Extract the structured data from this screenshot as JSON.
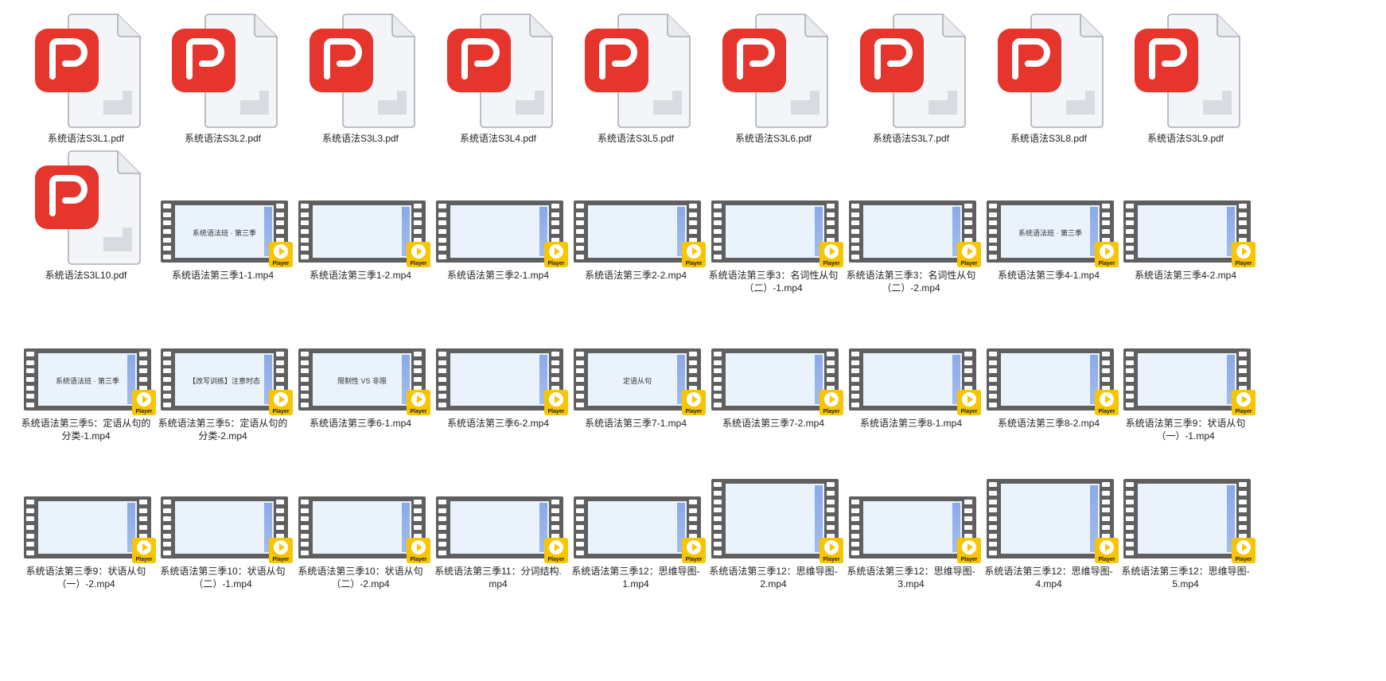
{
  "colors": {
    "pdf_red": "#e5352d",
    "player_yellow": "#f7c600",
    "film_gray": "#5f5f5f"
  },
  "player_badge": "Player",
  "files": [
    {
      "name": "系统语法S3L1.pdf",
      "type": "pdf"
    },
    {
      "name": "系统语法S3L2.pdf",
      "type": "pdf"
    },
    {
      "name": "系统语法S3L3.pdf",
      "type": "pdf"
    },
    {
      "name": "系统语法S3L4.pdf",
      "type": "pdf"
    },
    {
      "name": "系统语法S3L5.pdf",
      "type": "pdf"
    },
    {
      "name": "系统语法S3L6.pdf",
      "type": "pdf"
    },
    {
      "name": "系统语法S3L7.pdf",
      "type": "pdf"
    },
    {
      "name": "系统语法S3L8.pdf",
      "type": "pdf"
    },
    {
      "name": "系统语法S3L9.pdf",
      "type": "pdf"
    },
    {
      "name": "系统语法S3L10.pdf",
      "type": "pdf"
    },
    {
      "name": "系统语法第三季1-1.mp4",
      "type": "mp4",
      "screen": "系统语法班 · 第三季"
    },
    {
      "name": "系统语法第三季1-2.mp4",
      "type": "mp4"
    },
    {
      "name": "系统语法第三季2-1.mp4",
      "type": "mp4"
    },
    {
      "name": "系统语法第三季2-2.mp4",
      "type": "mp4"
    },
    {
      "name": "系统语法第三季3：名词性从句（二）-1.mp4",
      "type": "mp4"
    },
    {
      "name": "系统语法第三季3：名词性从句（二）-2.mp4",
      "type": "mp4"
    },
    {
      "name": "系统语法第三季4-1.mp4",
      "type": "mp4",
      "screen": "系统语法班 · 第三季"
    },
    {
      "name": "系统语法第三季4-2.mp4",
      "type": "mp4"
    },
    {
      "name": "系统语法第三季5：定语从句的分类-1.mp4",
      "type": "mp4",
      "screen": "系统语法班 · 第三季"
    },
    {
      "name": "系统语法第三季5：定语从句的分类-2.mp4",
      "type": "mp4",
      "screen": "【改写训练】注意时态"
    },
    {
      "name": "系统语法第三季6-1.mp4",
      "type": "mp4",
      "screen": "限制性 VS 非限"
    },
    {
      "name": "系统语法第三季6-2.mp4",
      "type": "mp4"
    },
    {
      "name": "系统语法第三季7-1.mp4",
      "type": "mp4",
      "screen": "定语从句"
    },
    {
      "name": "系统语法第三季7-2.mp4",
      "type": "mp4"
    },
    {
      "name": "系统语法第三季8-1.mp4",
      "type": "mp4"
    },
    {
      "name": "系统语法第三季8-2.mp4",
      "type": "mp4"
    },
    {
      "name": "系统语法第三季9：状语从句（一）-1.mp4",
      "type": "mp4"
    },
    {
      "name": "系统语法第三季9：状语从句（一）-2.mp4",
      "type": "mp4"
    },
    {
      "name": "系统语法第三季10：状语从句（二）-1.mp4",
      "type": "mp4"
    },
    {
      "name": "系统语法第三季10：状语从句（二）-2.mp4",
      "type": "mp4"
    },
    {
      "name": "系统语法第三季11：分词结构.mp4",
      "type": "mp4"
    },
    {
      "name": "系统语法第三季12：思维导图-1.mp4",
      "type": "mp4"
    },
    {
      "name": "系统语法第三季12：思维导图-2.mp4",
      "type": "mp4"
    },
    {
      "name": "系统语法第三季12：思维导图-3.mp4",
      "type": "mp4"
    },
    {
      "name": "系统语法第三季12：思维导图-4.mp4",
      "type": "mp4"
    },
    {
      "name": "系统语法第三季12：思维导图-5.mp4",
      "type": "mp4"
    }
  ]
}
